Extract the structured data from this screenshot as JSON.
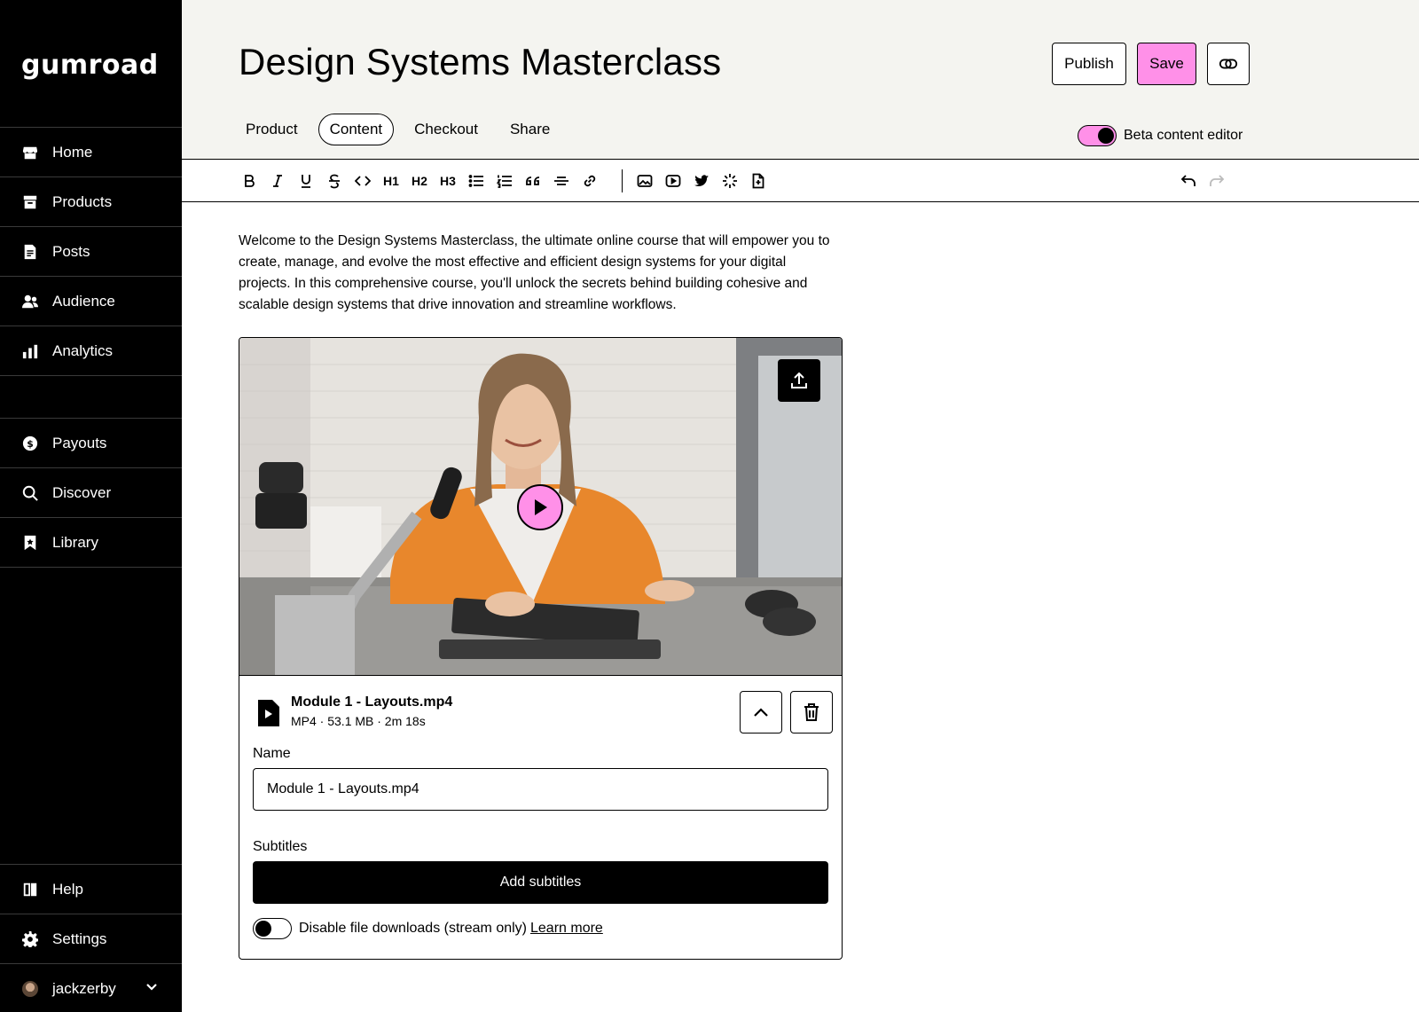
{
  "sidebar": {
    "logo": "Gumroad",
    "nav": [
      {
        "label": "Home",
        "icon": "store-icon"
      },
      {
        "label": "Products",
        "icon": "archive-icon"
      },
      {
        "label": "Posts",
        "icon": "document-icon"
      },
      {
        "label": "Audience",
        "icon": "people-icon"
      },
      {
        "label": "Analytics",
        "icon": "bar-chart-icon"
      }
    ],
    "nav2": [
      {
        "label": "Payouts",
        "icon": "dollar-circle-icon"
      },
      {
        "label": "Discover",
        "icon": "search-icon"
      },
      {
        "label": "Library",
        "icon": "bookmark-icon"
      }
    ],
    "bottom": [
      {
        "label": "Help",
        "icon": "book-icon"
      },
      {
        "label": "Settings",
        "icon": "gear-icon"
      }
    ],
    "user": {
      "name": "jackzerby"
    }
  },
  "header": {
    "title": "Design Systems Masterclass",
    "publish_label": "Publish",
    "save_label": "Save",
    "tabs": [
      {
        "label": "Product",
        "active": false
      },
      {
        "label": "Content",
        "active": true
      },
      {
        "label": "Checkout",
        "active": false
      },
      {
        "label": "Share",
        "active": false
      }
    ],
    "beta_label": "Beta content editor",
    "beta_enabled": true
  },
  "toolbar": {
    "buttons": [
      "bold",
      "italic",
      "underline",
      "strikethrough",
      "code",
      "heading-1",
      "heading-2",
      "heading-3",
      "bullet-list",
      "numbered-list",
      "quote",
      "horizontal-rule",
      "link",
      "image",
      "video",
      "twitter",
      "embed",
      "file",
      "undo",
      "redo"
    ],
    "h1": "H1",
    "h2": "H2",
    "h3": "H3"
  },
  "content": {
    "intro": "Welcome to the Design Systems Masterclass, the ultimate online course that will empower you to create, manage, and evolve the most effective and efficient design systems for your digital projects. In this comprehensive course, you'll unlock the secrets behind building cohesive and scalable design systems that drive innovation and streamline workflows.",
    "file": {
      "name": "Module 1 - Layouts.mp4",
      "meta": "MP4 · 53.1 MB · 2m 18s",
      "name_label": "Name",
      "name_value": "Module 1 - Layouts.mp4",
      "subtitles_label": "Subtitles",
      "add_subtitles_label": "Add subtitles",
      "disable_downloads_label": "Disable file downloads (stream only)",
      "disable_downloads_enabled": false,
      "learn_more_label": "Learn more"
    }
  },
  "colors": {
    "accent": "#ff90e8",
    "header_bg": "#f4f4f0",
    "sidebar_bg": "#000000"
  }
}
